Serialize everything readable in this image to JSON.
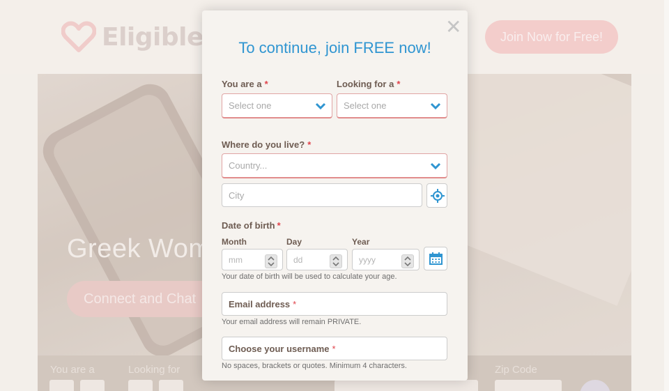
{
  "site": {
    "logo_text": "EligibleG",
    "join_button": "Join Now for Free!",
    "hero_title": "Greek Wom",
    "hero_button": "Connect and Chat",
    "strip_labels": [
      "You are a",
      "Looking for",
      "Zip Code"
    ]
  },
  "modal": {
    "title": "To continue, join FREE now!",
    "close": "✕",
    "you_are_label": "You are a",
    "you_are_placeholder": "Select one",
    "looking_for_label": "Looking for a",
    "looking_for_placeholder": "Select one",
    "where_label": "Where do you live?",
    "country_placeholder": "Country...",
    "city_placeholder": "City",
    "dob_label": "Date of birth",
    "month_label": "Month",
    "day_label": "Day",
    "year_label": "Year",
    "month_placeholder": "mm",
    "day_placeholder": "dd",
    "year_placeholder": "yyyy",
    "dob_help": "Your date of birth will be used to calculate your age.",
    "email_label": "Email address",
    "email_help": "Your email address will remain PRIVATE.",
    "username_label": "Choose your username",
    "username_help": "No spaces, brackets or quotes. Minimum 4 characters.",
    "required_mark": "*"
  },
  "colors": {
    "accent_blue": "#2f95d1",
    "required_red": "#e0434b",
    "brand_pink": "#f3c6c4"
  }
}
